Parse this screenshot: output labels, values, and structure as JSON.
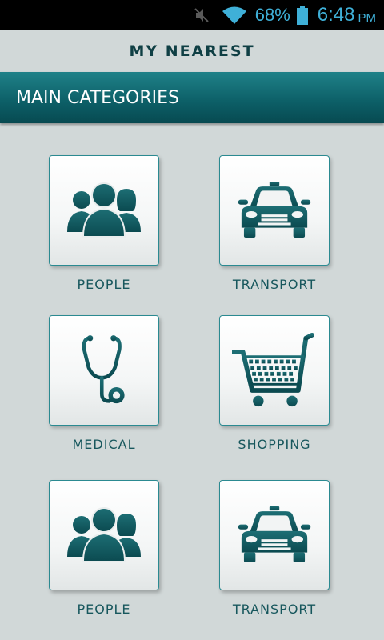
{
  "status_bar": {
    "battery_percent": "68%",
    "time": "6:48",
    "ampm": "PM",
    "icons": [
      "mute-icon",
      "wifi-icon",
      "battery-icon"
    ],
    "color": "#3fb0d8"
  },
  "header": {
    "title": "MY NEAREST"
  },
  "section": {
    "title": "MAIN CATEGORIES",
    "color": "#0c5e66"
  },
  "categories": [
    {
      "label": "PEOPLE",
      "icon": "people-icon"
    },
    {
      "label": "TRANSPORT",
      "icon": "taxi-icon"
    },
    {
      "label": "MEDICAL",
      "icon": "stethoscope-icon"
    },
    {
      "label": "SHOPPING",
      "icon": "shopping-cart-icon"
    },
    {
      "label": "PEOPLE",
      "icon": "people-icon"
    },
    {
      "label": "TRANSPORT",
      "icon": "taxi-icon"
    }
  ]
}
